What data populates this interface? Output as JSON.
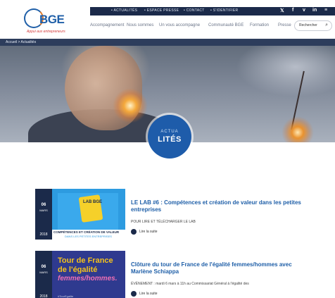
{
  "header": {
    "logo_text": "BGE",
    "logo_sub": "Appui aux entrepreneurs",
    "topbar_links": [
      "• ACTUALITÉS",
      "• ESPACE PRESSE",
      "• CONTACT",
      "• S'IDENTIFIER"
    ],
    "social_icons": [
      "twitter-icon",
      "facebook-icon",
      "vimeo-icon",
      "linkedin-icon",
      "rss-icon"
    ],
    "social_glyphs": [
      "𝕏",
      "f",
      "v",
      "in",
      "≡"
    ],
    "nav": [
      "Accompagnement",
      "Nous sommes",
      "Un vous accompagne",
      "Communauté BGE",
      "Formation",
      "Presse"
    ],
    "search_label": "Rechercher",
    "search_icon": "search-icon"
  },
  "hero": {
    "breadcrumb": "Accueil > Actualités",
    "badge_top": "ACTUA",
    "badge_bottom": "LITÉS"
  },
  "articles": [
    {
      "day": "06",
      "month": "MARS",
      "year": "2018",
      "title": "LE LAB #6 : Compétences et création de valeur dans les petites entreprises",
      "excerpt": "POUR LIRE ET TÉLÉCHARGER LE LAB",
      "readmore": "Lire la suite",
      "thumb": {
        "badge": "LAB BGE",
        "caption_1": "COMPÉTENCES ET CRÉATION DE VALEUR",
        "caption_2": "DANS LES PETITES ENTREPRISES"
      }
    },
    {
      "day": "06",
      "month": "MARS",
      "year": "2018",
      "title": "Clôture du tour de France de l'égalité femmes/hommes avec Marlène Schiappa",
      "excerpt": "ÉVÉNEMENT : mardi 6 mars à 11h au Commissariat Général à l'égalité des",
      "readmore": "Lire la suite",
      "thumb": {
        "line_1": "Tour de France",
        "line_2": "de l'égalité",
        "line_3": "femmes/hommes.",
        "footer": "#TourEgalite"
      }
    }
  ],
  "colors": {
    "brand_blue": "#1f5fa8",
    "navy": "#1b2a4a",
    "accent_orange": "#e07a2a"
  }
}
